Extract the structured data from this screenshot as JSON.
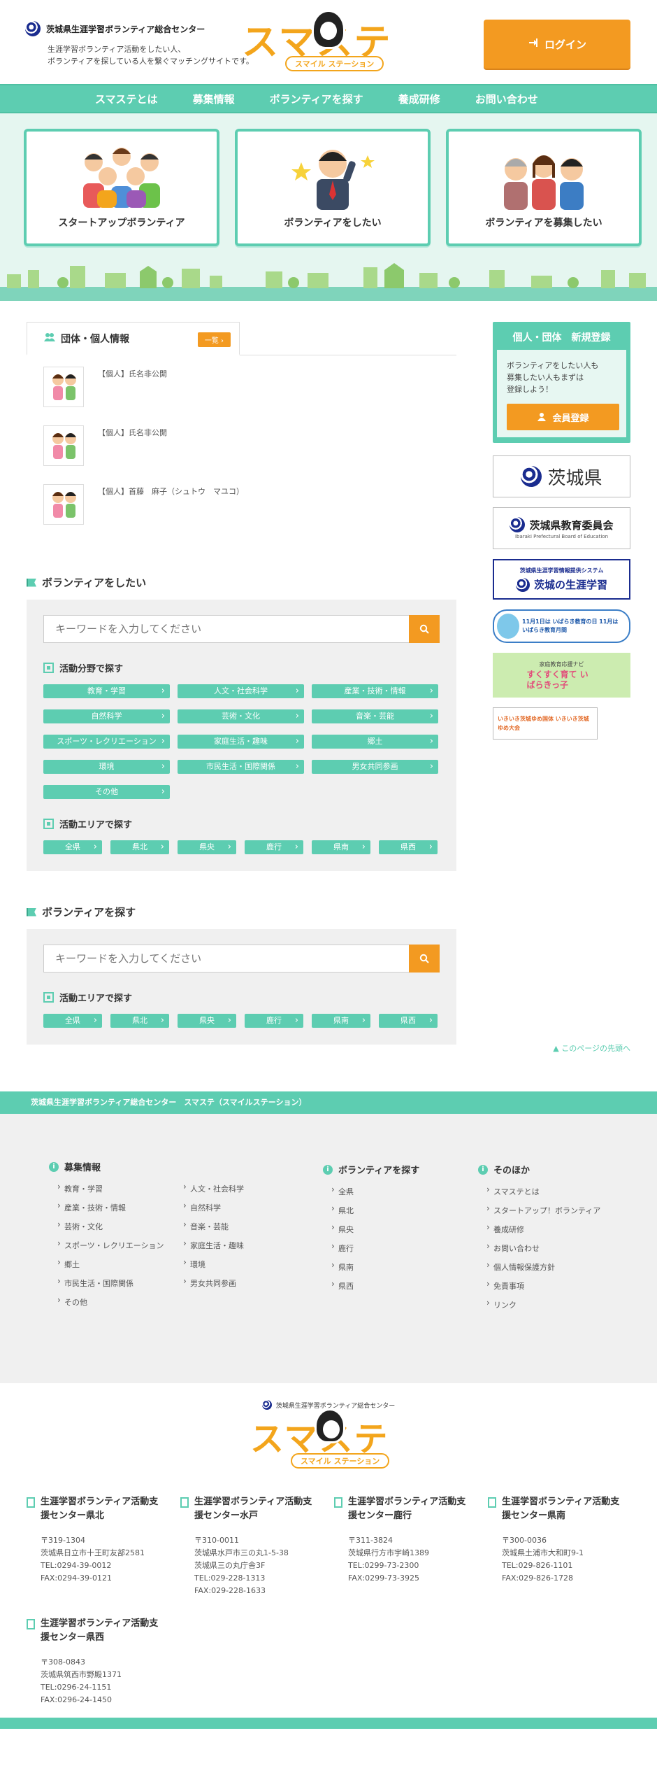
{
  "header": {
    "org_name": "茨城県生涯学習ボランティア総合センター",
    "tagline_line1": "生涯学習ボランティア活動をしたい人、",
    "tagline_line2": "ボランティアを探している人を繋ぐマッチングサイトです。",
    "brand_main": "スマステ",
    "brand_sub": "スマイル ステーション",
    "login_label": "ログイン"
  },
  "nav": [
    {
      "label": "スマステとは"
    },
    {
      "label": "募集情報"
    },
    {
      "label": "ボランティアを探す"
    },
    {
      "label": "養成研修"
    },
    {
      "label": "お問い合わせ"
    }
  ],
  "hero": {
    "cards": [
      {
        "label": "スタートアップボランティア"
      },
      {
        "label": "ボランティアをしたい"
      },
      {
        "label": "ボランティアを募集したい"
      }
    ]
  },
  "members": {
    "tab_label": "団体・個人情報",
    "more_label": "一覧",
    "items": [
      {
        "text": "【個人】氏名非公開"
      },
      {
        "text": "【個人】氏名非公開"
      },
      {
        "text": "【個人】首藤　麻子（シュトウ　マユコ）"
      }
    ]
  },
  "want": {
    "title": "ボランティアをしたい",
    "search_placeholder": "キーワードを入力してください",
    "field_title": "活動分野で探す",
    "fields": [
      "教育・学習",
      "人文・社会科学",
      "産業・技術・情報",
      "自然科学",
      "芸術・文化",
      "音楽・芸能",
      "スポーツ・レクリエーション",
      "家庭生活・趣味",
      "郷土",
      "環境",
      "市民生活・国際関係",
      "男女共同参画",
      "その他"
    ],
    "area_title": "活動エリアで探す",
    "areas": [
      "全県",
      "県北",
      "県央",
      "鹿行",
      "県南",
      "県西"
    ]
  },
  "find": {
    "title": "ボランティアを探す",
    "search_placeholder": "キーワードを入力してください",
    "area_title": "活動エリアで探す",
    "areas": [
      "全県",
      "県北",
      "県央",
      "鹿行",
      "県南",
      "県西"
    ]
  },
  "sidebar": {
    "register_head": "個人・団体　新規登録",
    "register_text1": "ボランティアをしたい人も",
    "register_text2": "募集したい人もまずは",
    "register_text3": "登録しよう！",
    "register_button": "会員登録",
    "banner1": "茨城県",
    "banner2": "茨城県教育委員会",
    "banner2_sub": "Ibaraki Prefectural Board of Education",
    "banner3_top": "茨城県生涯学習情報提供システム",
    "banner3": "茨城の生涯学習",
    "banner4": "11月1日は いばらき教育の日 11月は いばらき教育月間",
    "banner5_top": "家庭教育応援ナビ",
    "banner5": "すくすく育て いばらきっ子",
    "banner6": "いきいき茨城ゆめ国体 いきいき茨城ゆめ大会"
  },
  "pagetop": "このページの先頭へ",
  "footer": {
    "band": "茨城県生涯学習ボランティア総合センター　スマステ（スマイルステーション）",
    "sitemap": {
      "recruit_title": "募集情報",
      "recruit_col1": [
        "教育・学習",
        "産業・技術・情報",
        "芸術・文化",
        "スポーツ・レクリエーション",
        "郷土",
        "市民生活・国際関係",
        "その他"
      ],
      "recruit_col2": [
        "人文・社会科学",
        "自然科学",
        "音楽・芸能",
        "家庭生活・趣味",
        "環境",
        "男女共同参画"
      ],
      "find_title": "ボランティアを探す",
      "find_items": [
        "全県",
        "県北",
        "県央",
        "鹿行",
        "県南",
        "県西"
      ],
      "other_title": "そのほか",
      "other_items": [
        "スマステとは",
        "スタートアップ！ボランティア",
        "養成研修",
        "お問い合わせ",
        "個人情報保護方針",
        "免責事項",
        "リンク"
      ]
    },
    "bottom_org": "茨城県生涯学習ボランティア総合センター",
    "brand_main": "スマステ",
    "brand_sub": "スマイル ステーション",
    "offices": [
      {
        "title1": "生涯学習ボランティア活動支",
        "title2": "援センター県北",
        "zip": "〒319-1304",
        "addr": "茨城県日立市十王町友部2581",
        "tel": "TEL:0294-39-0012",
        "fax": "FAX:0294-39-0121"
      },
      {
        "title1": "生涯学習ボランティア活動支",
        "title2": "援センター水戸",
        "zip": "〒310-0011",
        "addr": "茨城県水戸市三の丸1-5-38",
        "addr2": "茨城県三の丸庁舎3F",
        "tel": "TEL:029-228-1313",
        "fax": "FAX:029-228-1633"
      },
      {
        "title1": "生涯学習ボランティア活動支",
        "title2": "援センター鹿行",
        "zip": "〒311-3824",
        "addr": "茨城県行方市宇崎1389",
        "tel": "TEL:0299-73-2300",
        "fax": "FAX:0299-73-3925"
      },
      {
        "title1": "生涯学習ボランティア活動支",
        "title2": "援センター県南",
        "zip": "〒300-0036",
        "addr": "茨城県土浦市大和町9-1",
        "tel": "TEL:029-826-1101",
        "fax": "FAX:029-826-1728"
      },
      {
        "title1": "生涯学習ボランティア活動支",
        "title2": "援センター県西",
        "zip": "〒308-0843",
        "addr": "茨城県筑西市野殿1371",
        "tel": "TEL:0296-24-1151",
        "fax": "FAX:0296-24-1450"
      }
    ]
  },
  "colors": {
    "accent": "#5dcdb1",
    "button": "#f39a21",
    "panel": "#f0f0f0"
  }
}
